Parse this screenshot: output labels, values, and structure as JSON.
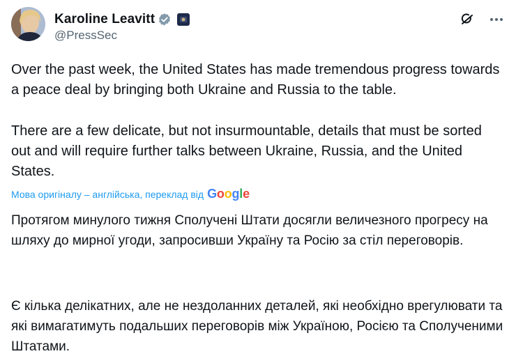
{
  "author": {
    "display_name": "Karoline Leavitt",
    "handle": "@PressSec"
  },
  "icons": {
    "verified": "verified-badge-icon",
    "affiliation": "government-affiliation-icon",
    "grok": "grok-icon",
    "more": "more-icon"
  },
  "colors": {
    "verified_blue": "#829aab",
    "link_blue": "#1d9bf0",
    "text": "#0f1419",
    "secondary": "#536471"
  },
  "tweet": {
    "paragraph_1": "Over the past week, the United States has made tremendous progress towards a peace deal by bringing both Ukraine and Russia to the table.",
    "paragraph_2": "There are a few delicate, but not insurmountable, details that must be sorted out and will require further talks between Ukraine, Russia, and the United States."
  },
  "translation": {
    "notice": "Мова оригіналу – англійська, переклад від",
    "provider": {
      "g1": "G",
      "o1": "o",
      "o2": "o",
      "g2": "g",
      "l": "l",
      "e": "e"
    },
    "paragraph_1": "Протягом минулого тижня Сполучені Штати досягли величезного прогресу на шляху до мирної угоди, запросивши Україну та Росію за стіл переговорів.",
    "paragraph_2": "Є кілька делікатних, але не нездоланних деталей, які необхідно врегулювати та які вимагатимуть подальших переговорів між Україною, Росією та Сполученими Штатами."
  }
}
